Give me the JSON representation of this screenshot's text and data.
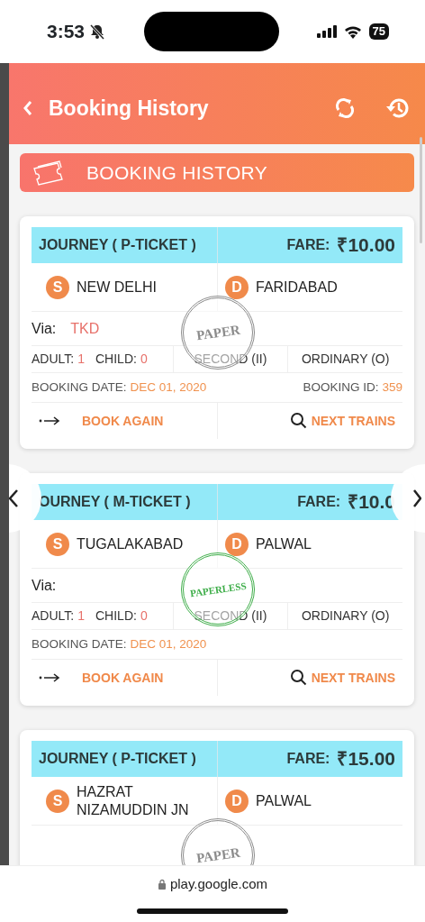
{
  "status_bar": {
    "time": "3:53",
    "battery": "75"
  },
  "header": {
    "title": "Booking History"
  },
  "banner": {
    "title": "BOOKING HISTORY"
  },
  "bookings": [
    {
      "journey": "JOURNEY ( P-TICKET )",
      "fare_label": "FARE:",
      "fare": "₹10.00",
      "source_badge": "S",
      "source": "NEW DELHI",
      "dest_badge": "D",
      "destination": "FARIDABAD",
      "via_label": "Via:",
      "via": "TKD",
      "adult_label": "ADULT:",
      "adult": "1",
      "child_label": "CHILD:",
      "child": "0",
      "class": "SECOND (II)",
      "type": "ORDINARY (O)",
      "date_label": "BOOKING DATE:",
      "date": "DEC 01, 2020",
      "id_label": "BOOKING ID:",
      "id": "359",
      "book_again": "BOOK AGAIN",
      "next_trains": "NEXT TRAINS",
      "stamp": {
        "text": "PAPER",
        "color": "#8c8c8c"
      }
    },
    {
      "journey": "OURNEY ( M-TICKET )",
      "fare_label": "FARE:",
      "fare": "₹10.0",
      "source_badge": "S",
      "source": "TUGALAKABAD",
      "dest_badge": "D",
      "destination": "PALWAL",
      "via_label": "Via:",
      "adult_label": "ADULT:",
      "adult": "1",
      "child_label": "CHILD:",
      "child": "0",
      "class": "SECOND (II)",
      "type": "ORDINARY (O)",
      "date_label": "BOOKING DATE:",
      "date": "DEC 01, 2020",
      "book_again": "BOOK AGAIN",
      "next_trains": "NEXT TRAINS",
      "stamp": {
        "text": "PAPERLESS",
        "color": "#3fae4a"
      }
    },
    {
      "journey": "JOURNEY ( P-TICKET )",
      "fare_label": "FARE:",
      "fare": "₹15.00",
      "source_badge": "S",
      "source": "HAZRAT NIZAMUDDIN JN",
      "dest_badge": "D",
      "destination": "PALWAL",
      "stamp": {
        "text": "PAPER",
        "color": "#8c8c8c"
      }
    }
  ],
  "browser_bar": {
    "url": "play.google.com"
  }
}
